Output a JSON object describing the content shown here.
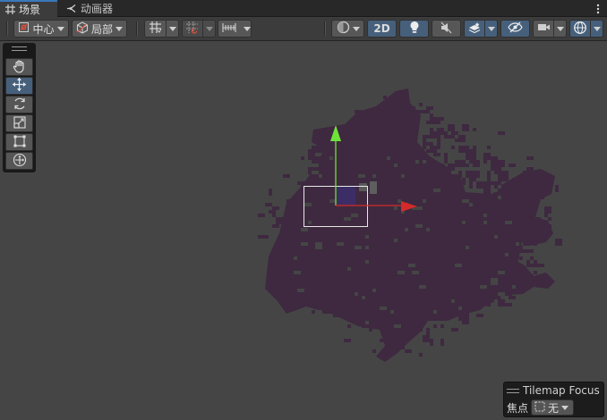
{
  "tabs": [
    {
      "label": "场景",
      "icon": "grid-icon",
      "active": true
    },
    {
      "label": "动画器",
      "icon": "animator-icon",
      "active": false
    }
  ],
  "toolbar": {
    "pivot_label": "中心",
    "space_label": "局部",
    "mode_2d_label": "2D"
  },
  "tools": [
    {
      "name": "hand-tool",
      "icon": "hand-icon",
      "selected": false
    },
    {
      "name": "move-tool",
      "icon": "move-icon",
      "selected": true
    },
    {
      "name": "rotate-tool",
      "icon": "rotate-icon",
      "selected": false
    },
    {
      "name": "scale-tool",
      "icon": "scale-icon",
      "selected": false
    },
    {
      "name": "rect-tool",
      "icon": "rect-icon",
      "selected": false
    },
    {
      "name": "transform-tool",
      "icon": "transform-icon",
      "selected": false
    }
  ],
  "tilemap_focus": {
    "title": "Tilemap Focus",
    "focus_label": "焦点",
    "focus_value": "无"
  },
  "colors": {
    "scene_bg": "#454545",
    "tilemap": "#3e2940",
    "accent": "#3a79bb",
    "x_axis": "#d42a2a",
    "y_axis": "#6fe23a"
  }
}
